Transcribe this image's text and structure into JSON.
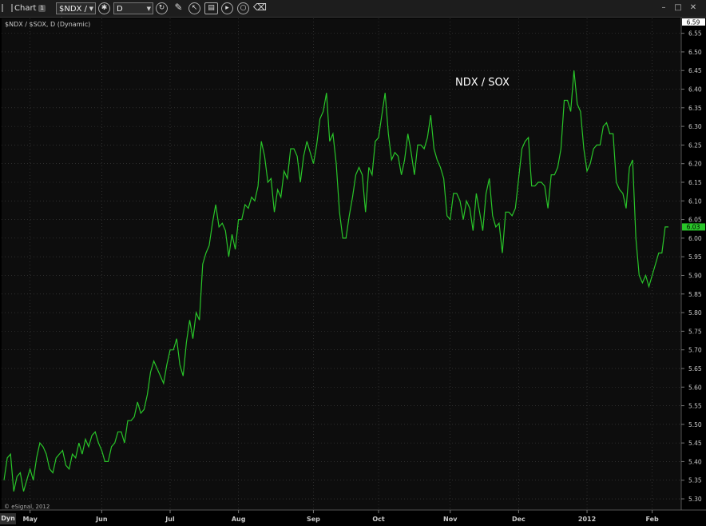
{
  "window": {
    "title": "Chart",
    "badge": "1",
    "symbol_value": "$NDX / $S",
    "interval_value": "D",
    "dyn_label": "Dyn"
  },
  "colors": {
    "line": "#29c529",
    "background": "#0d0d0d",
    "grid": "#444444",
    "axis_text": "#c8c8c8",
    "last_value_bg": "#29c529"
  },
  "icons": [
    "bars-grip-icon",
    "settings-gear-icon",
    "refresh-icon",
    "pencil-icon",
    "cursor-arrow-icon",
    "layout-icon",
    "play-icon",
    "zoom-icon",
    "eraser-icon",
    "minimize-icon",
    "maximize-icon",
    "close-icon"
  ],
  "chart_data": {
    "type": "line",
    "study_label": "$NDX / $SOX, D (Dynamic)",
    "annotation": "NDX / SOX",
    "copyright": "© eSignal, 2012",
    "last_value_label": "6.03",
    "grid": true,
    "ylim": [
      5.27,
      6.59
    ],
    "yticks": [
      5.3,
      5.35,
      5.4,
      5.45,
      5.5,
      5.55,
      5.6,
      5.65,
      5.7,
      5.75,
      5.8,
      5.85,
      5.9,
      5.95,
      6.0,
      6.05,
      6.1,
      6.15,
      6.2,
      6.25,
      6.3,
      6.35,
      6.4,
      6.45,
      6.5,
      6.55
    ],
    "ytick_labels": [
      "5.30",
      "5.35",
      "5.40",
      "5.45",
      "5.50",
      "5.55",
      "5.60",
      "5.65",
      "5.70",
      "5.75",
      "5.80",
      "5.85",
      "5.90",
      "5.95",
      "6.00",
      "6.05",
      "6.10",
      "6.15",
      "6.20",
      "6.25",
      "6.30",
      "6.35",
      "6.40",
      "6.45",
      "6.50",
      "6.55"
    ],
    "top_label": "6.59",
    "xticks": [
      {
        "label": "May",
        "index": 8
      },
      {
        "label": "Jun",
        "index": 30
      },
      {
        "label": "Jul",
        "index": 51
      },
      {
        "label": "Aug",
        "index": 72
      },
      {
        "label": "Sep",
        "index": 95
      },
      {
        "label": "Oct",
        "index": 115
      },
      {
        "label": "Nov",
        "index": 137
      },
      {
        "label": "Dec",
        "index": 158
      },
      {
        "label": "2012",
        "index": 179
      },
      {
        "label": "Feb",
        "index": 199
      }
    ],
    "series": [
      {
        "values": [
          5.35,
          5.41,
          5.42,
          5.32,
          5.36,
          5.37,
          5.32,
          5.35,
          5.38,
          5.35,
          5.41,
          5.45,
          5.44,
          5.42,
          5.38,
          5.37,
          5.41,
          5.42,
          5.43,
          5.39,
          5.38,
          5.42,
          5.41,
          5.45,
          5.42,
          5.46,
          5.44,
          5.47,
          5.48,
          5.45,
          5.43,
          5.4,
          5.4,
          5.44,
          5.45,
          5.48,
          5.48,
          5.45,
          5.51,
          5.51,
          5.52,
          5.56,
          5.53,
          5.54,
          5.58,
          5.64,
          5.67,
          5.65,
          5.63,
          5.61,
          5.66,
          5.7,
          5.7,
          5.73,
          5.66,
          5.63,
          5.72,
          5.78,
          5.73,
          5.8,
          5.78,
          5.93,
          5.96,
          5.98,
          6.04,
          6.09,
          6.03,
          6.04,
          6.02,
          5.95,
          6.01,
          5.97,
          6.05,
          6.05,
          6.09,
          6.08,
          6.11,
          6.1,
          6.14,
          6.26,
          6.22,
          6.15,
          6.16,
          6.07,
          6.13,
          6.11,
          6.18,
          6.16,
          6.24,
          6.24,
          6.22,
          6.15,
          6.22,
          6.26,
          6.23,
          6.2,
          6.25,
          6.32,
          6.34,
          6.39,
          6.26,
          6.28,
          6.2,
          6.07,
          6.0,
          6.0,
          6.06,
          6.11,
          6.17,
          6.19,
          6.17,
          6.07,
          6.19,
          6.17,
          6.26,
          6.27,
          6.33,
          6.39,
          6.28,
          6.21,
          6.23,
          6.22,
          6.17,
          6.21,
          6.28,
          6.23,
          6.17,
          6.25,
          6.25,
          6.24,
          6.27,
          6.33,
          6.24,
          6.21,
          6.19,
          6.16,
          6.06,
          6.05,
          6.12,
          6.12,
          6.1,
          6.05,
          6.1,
          6.08,
          6.02,
          6.12,
          6.07,
          6.02,
          6.12,
          6.16,
          6.06,
          6.03,
          6.04,
          5.96,
          6.07,
          6.07,
          6.06,
          6.08,
          6.16,
          6.24,
          6.26,
          6.27,
          6.14,
          6.14,
          6.15,
          6.15,
          6.14,
          6.08,
          6.17,
          6.17,
          6.19,
          6.24,
          6.37,
          6.37,
          6.34,
          6.45,
          6.36,
          6.34,
          6.24,
          6.18,
          6.2,
          6.24,
          6.25,
          6.25,
          6.3,
          6.31,
          6.28,
          6.28,
          6.15,
          6.13,
          6.12,
          6.08,
          6.19,
          6.21,
          6.0,
          5.9,
          5.88,
          5.9,
          5.87,
          5.9,
          5.93,
          5.96,
          5.96,
          6.03,
          6.03
        ]
      }
    ]
  }
}
